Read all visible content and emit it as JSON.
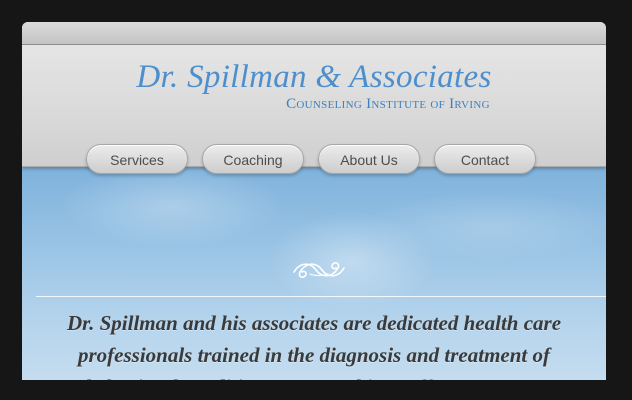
{
  "site": {
    "title": "Dr. Spillman & Associates",
    "subtitle": "Counseling Institute of Irving"
  },
  "nav": {
    "items": [
      {
        "label": "Services"
      },
      {
        "label": "Coaching"
      },
      {
        "label": "About Us"
      },
      {
        "label": "Contact"
      }
    ]
  },
  "hero": {
    "lines": [
      "Dr. Spillman and his associates are dedicated health care",
      "professionals trained in the diagnosis and treatment of",
      "behavioral conditions. Our goal is to offer competent"
    ]
  },
  "colors": {
    "brand_blue": "#4d8fcc",
    "background": "#161616"
  },
  "icons": {
    "flourish": "ornamental-flourish-icon"
  }
}
